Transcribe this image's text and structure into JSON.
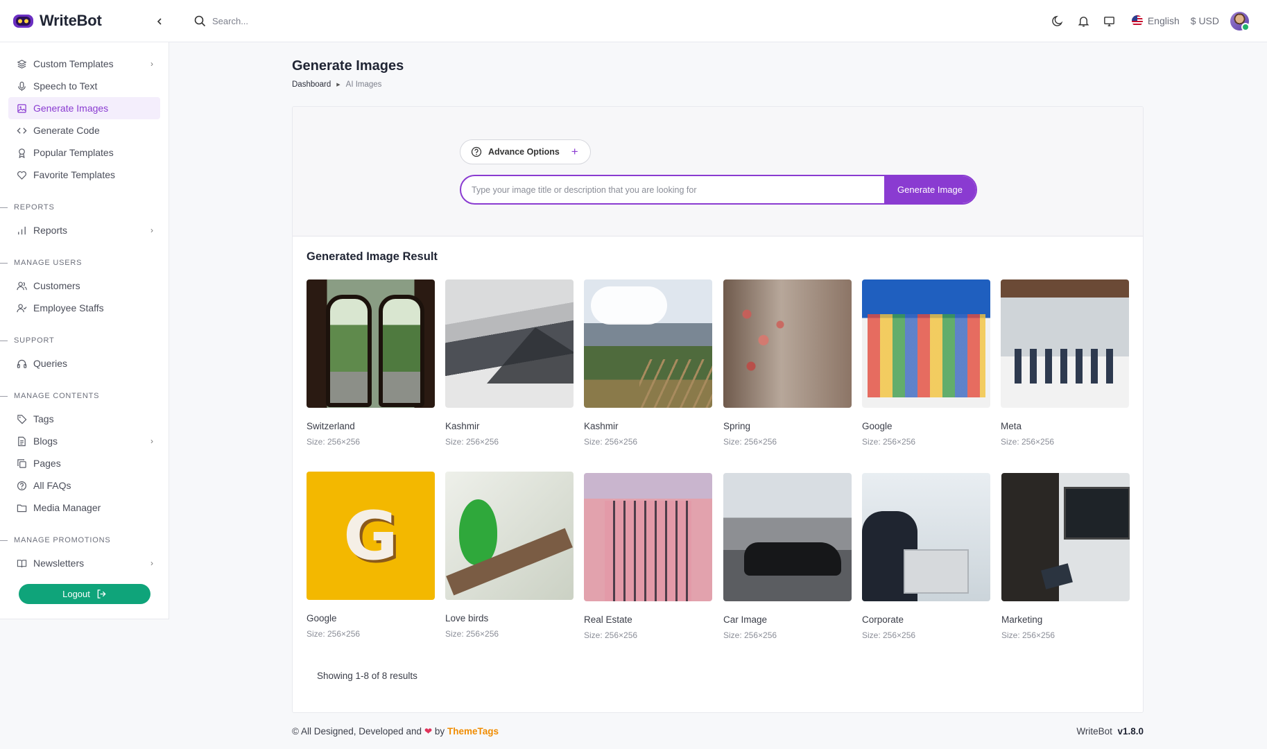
{
  "app": {
    "name": "WriteBot",
    "accent": "#8a3bd1",
    "success": "#0fa47a"
  },
  "header": {
    "search_placeholder": "Search...",
    "language": "English",
    "currency": "$ USD",
    "icons": [
      "moon-icon",
      "bell-icon",
      "monitor-icon"
    ]
  },
  "sidebar": {
    "items_top": [
      {
        "label": "Custom Templates",
        "icon": "layers-icon",
        "chevron": true
      },
      {
        "label": "Speech to Text",
        "icon": "microphone-icon",
        "chevron": false
      },
      {
        "label": "Generate Images",
        "icon": "image-icon",
        "chevron": false,
        "active": true
      },
      {
        "label": "Generate Code",
        "icon": "code-icon",
        "chevron": false
      },
      {
        "label": "Popular Templates",
        "icon": "award-icon",
        "chevron": false
      },
      {
        "label": "Favorite Templates",
        "icon": "heart-icon",
        "chevron": false
      }
    ],
    "sections": {
      "reports": {
        "title": "REPORTS",
        "items": [
          {
            "label": "Reports"
          }
        ]
      },
      "manage_users": {
        "title": "MANAGE USERS",
        "items": [
          {
            "label": "Customers"
          },
          {
            "label": "Employee Staffs"
          }
        ]
      },
      "support": {
        "title": "SUPPORT",
        "items": [
          {
            "label": "Queries"
          }
        ]
      },
      "manage_contents": {
        "title": "MANAGE CONTENTS",
        "items": [
          {
            "label": "Tags"
          },
          {
            "label": "Blogs"
          },
          {
            "label": "Pages"
          },
          {
            "label": "All FAQs"
          },
          {
            "label": "Media Manager"
          }
        ]
      },
      "manage_promotions": {
        "title": "MANAGE PROMOTIONS",
        "items": [
          {
            "label": "Newsletters"
          }
        ]
      }
    },
    "logout_label": "Logout"
  },
  "page": {
    "title": "Generate Images",
    "breadcrumb": {
      "home": "Dashboard",
      "current": "AI Images"
    }
  },
  "generator": {
    "advance_options_label": "Advance Options",
    "prompt_placeholder": "Type your image title or description that you are looking for",
    "generate_button": "Generate Image"
  },
  "results": {
    "title": "Generated Image Result",
    "images": [
      {
        "name": "Switzerland",
        "size": "Size: 256×256"
      },
      {
        "name": "Kashmir",
        "size": "Size: 256×256"
      },
      {
        "name": "Kashmir",
        "size": "Size: 256×256"
      },
      {
        "name": "Spring",
        "size": "Size: 256×256"
      },
      {
        "name": "Google",
        "size": "Size: 256×256"
      },
      {
        "name": "Meta",
        "size": "Size: 256×256"
      },
      {
        "name": "Google",
        "size": "Size: 256×256"
      },
      {
        "name": "Love birds",
        "size": "Size: 256×256"
      },
      {
        "name": "Real Estate",
        "size": "Size: 256×256"
      },
      {
        "name": "Car Image",
        "size": "Size: 256×256"
      },
      {
        "name": "Corporate",
        "size": "Size: 256×256"
      },
      {
        "name": "Marketing",
        "size": "Size: 256×256"
      }
    ],
    "showing": "Showing 1-8 of 8 results"
  },
  "footer": {
    "credit_prefix": "© All Designed, Developed and",
    "credit_by": "by",
    "credit_brand": "ThemeTags",
    "product": "WriteBot",
    "version": "v1.8.0"
  }
}
